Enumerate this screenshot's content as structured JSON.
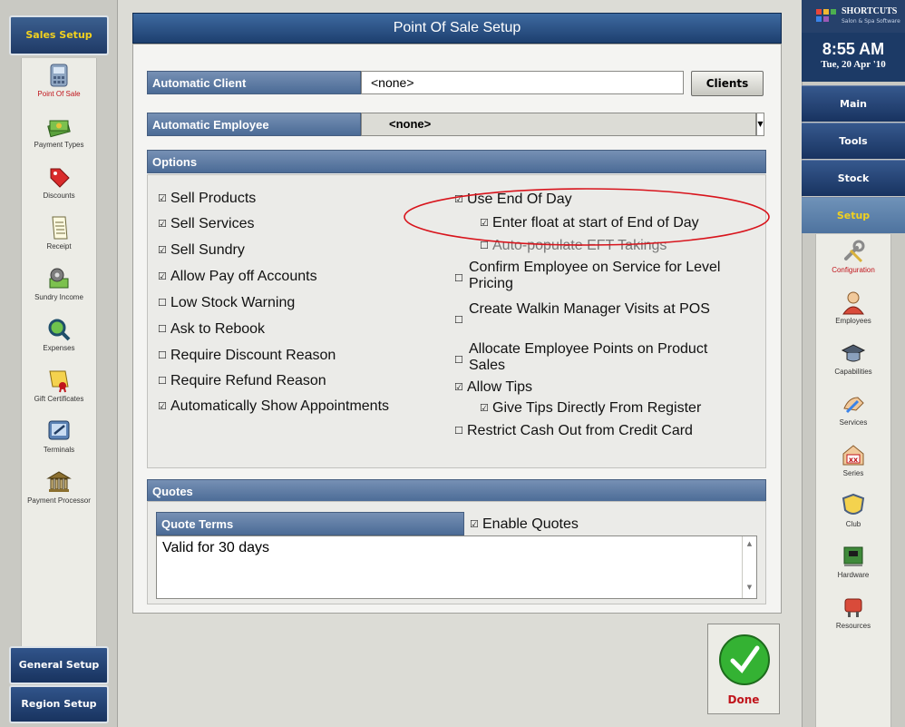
{
  "left_nav": {
    "header": "Sales Setup",
    "items": [
      {
        "label": "Point Of Sale",
        "icon": "pos-terminal-icon",
        "active": true
      },
      {
        "label": "Payment Types",
        "icon": "money-stack-icon"
      },
      {
        "label": "Discounts",
        "icon": "price-tag-icon"
      },
      {
        "label": "Receipt",
        "icon": "receipt-icon"
      },
      {
        "label": "Sundry Income",
        "icon": "gears-money-icon"
      },
      {
        "label": "Expenses",
        "icon": "magnifier-money-icon"
      },
      {
        "label": "Gift Certificates",
        "icon": "gift-certificate-icon"
      },
      {
        "label": "Terminals",
        "icon": "terminal-edit-icon"
      },
      {
        "label": "Payment Processor",
        "icon": "bank-icon"
      }
    ],
    "bottom_buttons": [
      "General Setup",
      "Region Setup"
    ]
  },
  "page": {
    "title": "Point Of Sale Setup",
    "automatic_client": {
      "label": "Automatic Client",
      "value": "<none>",
      "button": "Clients"
    },
    "automatic_employee": {
      "label": "Automatic Employee",
      "value": "<none>"
    },
    "options_header": "Options",
    "options_left": [
      {
        "label": "Sell Products",
        "checked": true
      },
      {
        "label": "Sell Services",
        "checked": true
      },
      {
        "label": "Sell Sundry",
        "checked": true
      },
      {
        "label": "Allow Pay off Accounts",
        "checked": true
      },
      {
        "label": "Low Stock Warning",
        "checked": false
      },
      {
        "label": "Ask to Rebook",
        "checked": false
      },
      {
        "label": "Require Discount Reason",
        "checked": false
      },
      {
        "label": "Require Refund Reason",
        "checked": false
      },
      {
        "label": "Automatically Show Appointments",
        "checked": true
      }
    ],
    "options_right": [
      {
        "label": "Use End Of Day",
        "checked": true
      },
      {
        "label": "Enter float at start of End of Day",
        "checked": true
      },
      {
        "label": "Auto-populate EFT Takings",
        "checked": false
      },
      {
        "label": "Confirm Employee on Service for Level Pricing",
        "checked": false
      },
      {
        "label": "Create Walkin Manager Visits at POS",
        "checked": false
      },
      {
        "label": "Allocate Employee Points on Product Sales",
        "checked": false
      },
      {
        "label": "Allow Tips",
        "checked": true
      },
      {
        "label": "Give Tips Directly From Register",
        "checked": true
      },
      {
        "label": "Restrict Cash Out from Credit Card",
        "checked": false
      }
    ],
    "quotes_header": "Quotes",
    "quote_terms_label": "Quote Terms",
    "enable_quotes": {
      "label": "Enable Quotes",
      "checked": true
    },
    "quote_terms_value": "Valid for 30 days",
    "done_label": "Done"
  },
  "right_nav": {
    "brand": "SHORTCUTS",
    "brand_sub": "Salon & Spa Software",
    "time": "8:55 AM",
    "date": "Tue, 20 Apr '10",
    "menu": [
      "Main",
      "Tools",
      "Stock",
      "Setup"
    ],
    "active_menu": "Setup",
    "items": [
      {
        "label": "Configuration",
        "icon": "wrench-icon",
        "active": true
      },
      {
        "label": "Employees",
        "icon": "person-icon"
      },
      {
        "label": "Capabilities",
        "icon": "graduation-cap-icon"
      },
      {
        "label": "Services",
        "icon": "hand-service-icon"
      },
      {
        "label": "Series",
        "icon": "series-xx-icon"
      },
      {
        "label": "Club",
        "icon": "shield-icon"
      },
      {
        "label": "Hardware",
        "icon": "circuit-board-icon"
      },
      {
        "label": "Resources",
        "icon": "resources-icon"
      }
    ]
  },
  "colors": {
    "accent_red": "#c0141b",
    "nav_blue": "#1f3a66",
    "highlight_yellow": "#f2d11e"
  }
}
